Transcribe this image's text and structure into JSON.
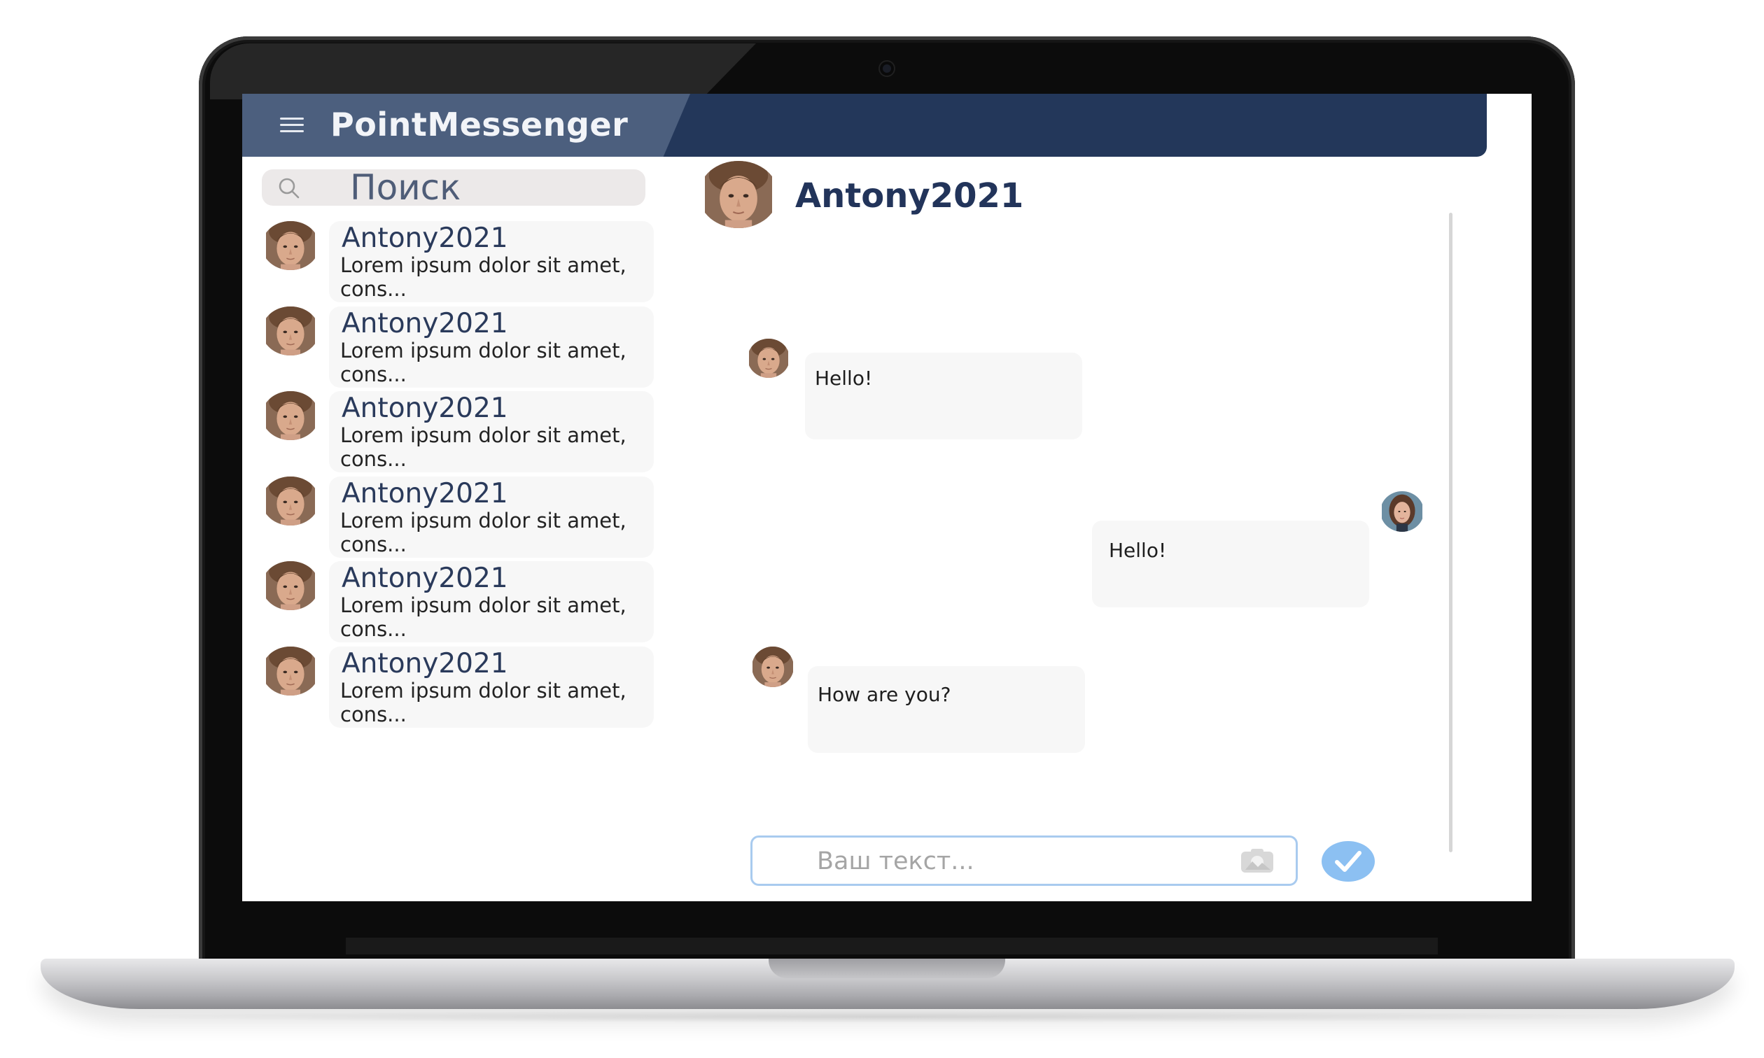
{
  "app": {
    "title": "PointMessenger"
  },
  "search": {
    "placeholder": "Поиск"
  },
  "chat_list": [
    {
      "name": "Antony2021",
      "preview": "Lorem ipsum dolor sit amet, cons..."
    },
    {
      "name": "Antony2021",
      "preview": "Lorem ipsum dolor sit amet, cons..."
    },
    {
      "name": "Antony2021",
      "preview": "Lorem ipsum dolor sit amet, cons..."
    },
    {
      "name": "Antony2021",
      "preview": "Lorem ipsum dolor sit amet, cons..."
    },
    {
      "name": "Antony2021",
      "preview": "Lorem ipsum dolor sit amet, cons..."
    },
    {
      "name": "Antony2021",
      "preview": "Lorem ipsum dolor sit amet, cons..."
    }
  ],
  "conversation": {
    "contact_name": "Antony2021",
    "messages": [
      {
        "sender": "contact",
        "text": "Hello!"
      },
      {
        "sender": "me",
        "text": "Hello!"
      },
      {
        "sender": "contact",
        "text": "How are you?"
      }
    ]
  },
  "composer": {
    "placeholder": "Ваш текст..."
  },
  "icons": {
    "menu": "menu-icon",
    "search": "search-icon",
    "attach": "image-attach-icon",
    "send": "check-icon"
  },
  "colors": {
    "header": "#23375a",
    "header_accent": "#4c5f7e",
    "name_text": "#22345a",
    "bubble": "#f7f7f7",
    "send_button": "#8cc0f2",
    "composer_border": "#a9cbef"
  }
}
